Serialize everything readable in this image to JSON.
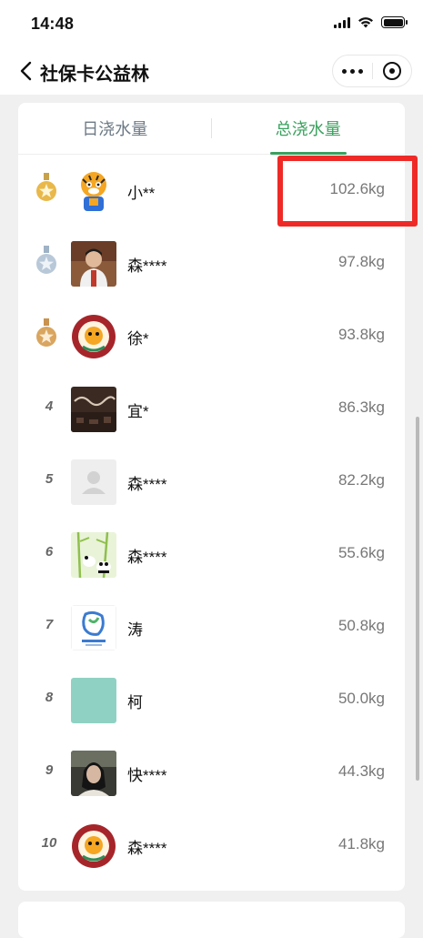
{
  "status": {
    "time": "14:48"
  },
  "nav": {
    "title": "社保卡公益林"
  },
  "tabs": [
    {
      "label": "日浇水量",
      "active": false
    },
    {
      "label": "总浇水量",
      "active": true
    }
  ],
  "accent_color": "#3aa15e",
  "highlight_color": "#ef2a26",
  "rows": [
    {
      "rank": "1",
      "medal": "gold",
      "avatar": "tiger-cartoon",
      "name": "小**",
      "weight": "102.6kg"
    },
    {
      "rank": "2",
      "medal": "silver",
      "avatar": "person-photo",
      "name": "森****",
      "weight": "97.8kg"
    },
    {
      "rank": "3",
      "medal": "bronze",
      "avatar": "tiger-logo",
      "name": "徐*",
      "weight": "93.8kg"
    },
    {
      "rank": "4",
      "medal": null,
      "avatar": "dark-photo",
      "name": "宜*",
      "weight": "86.3kg"
    },
    {
      "rank": "5",
      "medal": null,
      "avatar": "default-avatar",
      "name": "森****",
      "weight": "82.2kg"
    },
    {
      "rank": "6",
      "medal": null,
      "avatar": "panda-bamboo",
      "name": "森****",
      "weight": "55.6kg"
    },
    {
      "rank": "7",
      "medal": null,
      "avatar": "sichuan-logo",
      "name": "涛",
      "weight": "50.8kg"
    },
    {
      "rank": "8",
      "medal": null,
      "avatar": "teal-square",
      "name": "柯",
      "weight": "50.0kg"
    },
    {
      "rank": "9",
      "medal": null,
      "avatar": "woman-photo",
      "name": "快****",
      "weight": "44.3kg"
    },
    {
      "rank": "10",
      "medal": null,
      "avatar": "tiger-logo",
      "name": "森****",
      "weight": "41.8kg"
    }
  ]
}
